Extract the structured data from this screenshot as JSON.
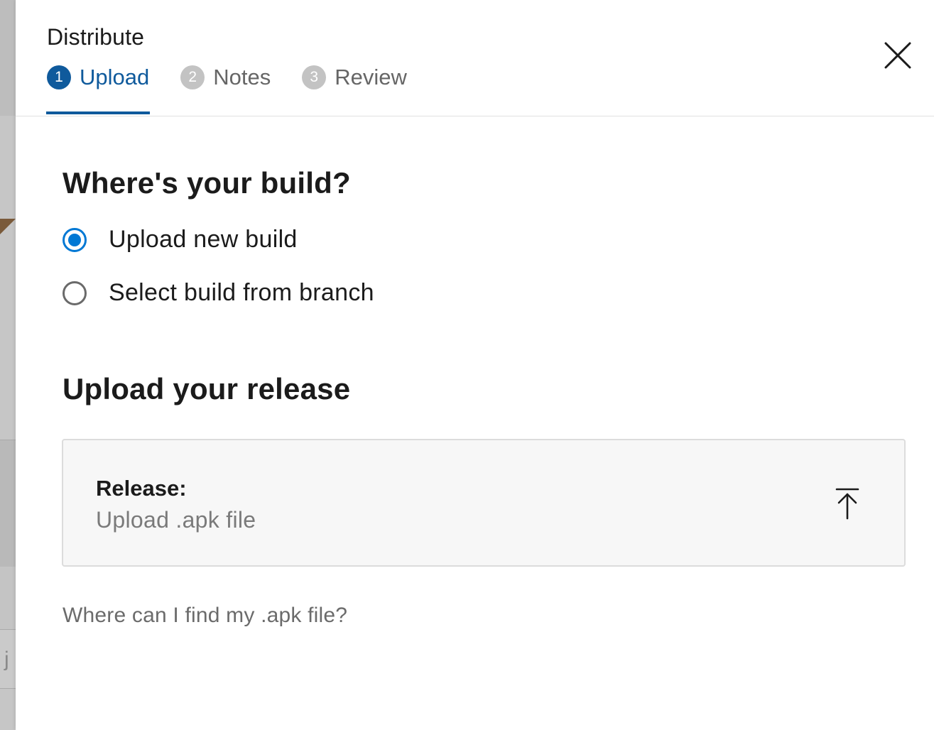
{
  "backdrop": {
    "peek_text": "j"
  },
  "panel": {
    "title": "Distribute",
    "close_icon": "close-icon"
  },
  "stepper": {
    "steps": [
      {
        "number": "1",
        "label": "Upload",
        "state": "active"
      },
      {
        "number": "2",
        "label": "Notes",
        "state": "inactive"
      },
      {
        "number": "3",
        "label": "Review",
        "state": "inactive"
      }
    ]
  },
  "build_source": {
    "heading": "Where's your build?",
    "options": [
      {
        "label": "Upload new build",
        "checked": true
      },
      {
        "label": "Select build from branch",
        "checked": false
      }
    ]
  },
  "release": {
    "heading": "Upload your release",
    "field_label": "Release:",
    "placeholder": "Upload .apk file",
    "icon": "upload-icon",
    "help_link": "Where can I find my .apk file?"
  },
  "colors": {
    "accent": "#0f5a9c",
    "radio_checked": "#0078d4",
    "inactive_step": "#c3c3c3",
    "upload_box_bg": "#f7f7f7"
  }
}
